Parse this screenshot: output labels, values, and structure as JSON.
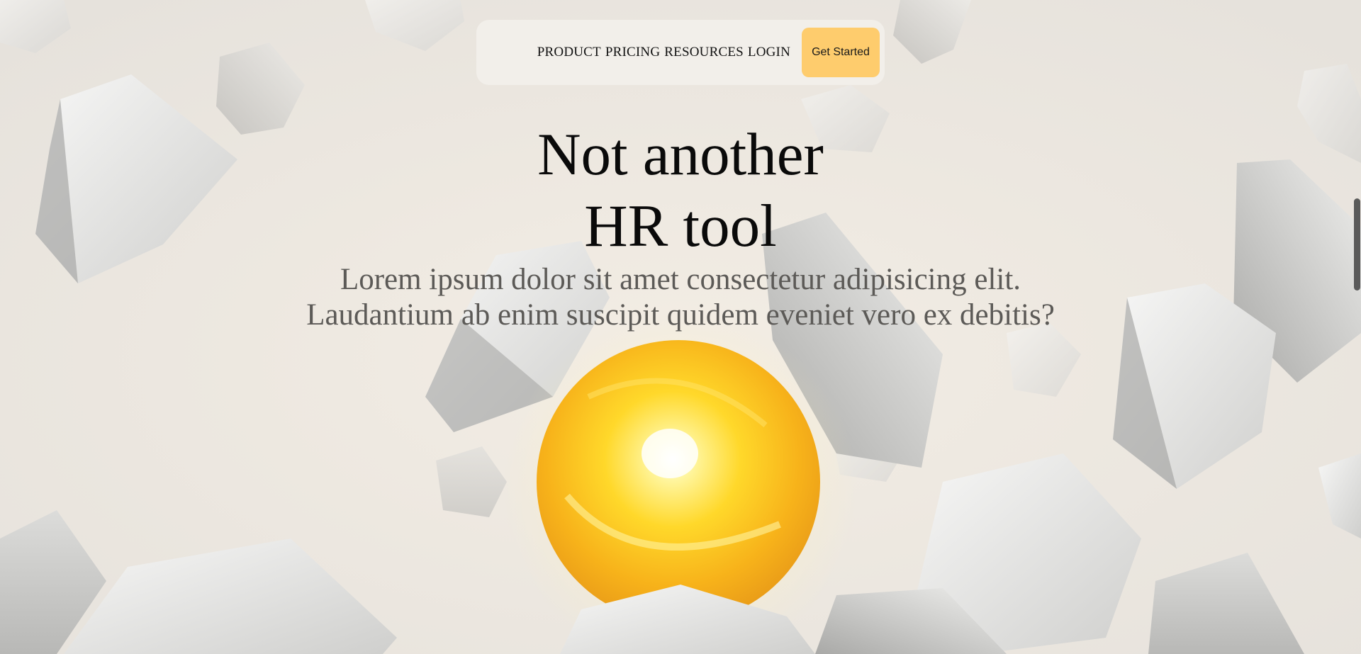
{
  "nav": {
    "links": [
      "PRODUCT",
      "PRICING",
      "RESOURCES",
      "LOGIN"
    ],
    "cta_label": "Get Started"
  },
  "hero": {
    "title_line1": "Not another",
    "title_line2": "HR tool",
    "subtitle_line1": "Lorem ipsum dolor sit amet consectetur adipisicing elit.",
    "subtitle_line2": "Laudantium ab enim suscipit quidem eveniet vero ex debitis?"
  },
  "colors": {
    "background": "#ebe6df",
    "cta": "#fecc6d",
    "orb": "#ffc21a"
  }
}
